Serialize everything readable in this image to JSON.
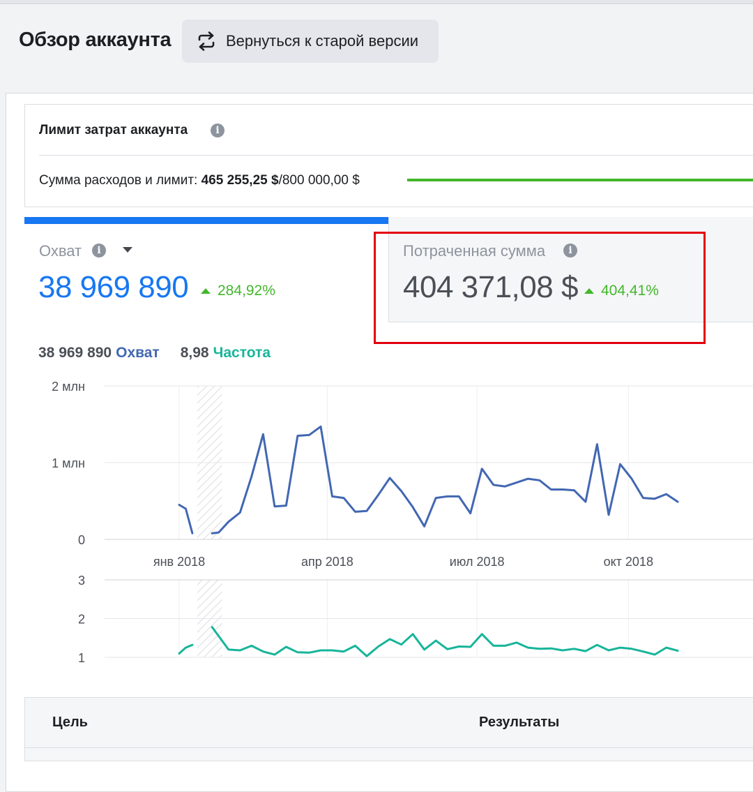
{
  "header": {
    "title": "Обзор аккаунта",
    "back_button": "Вернуться к старой версии",
    "back_icon": "refresh-arrows-icon"
  },
  "spend_limit": {
    "title": "Лимит затрат аккаунта",
    "label": "Сумма расходов и лимит: ",
    "spent": "465 255,25 $",
    "limit": "/800 000,00 $",
    "bar_color": "#42b72a"
  },
  "metrics": {
    "reach": {
      "label": "Охват",
      "value": "38 969 890",
      "change": "284,92%",
      "color": "#1877f2"
    },
    "spend": {
      "label": "Потраченная сумма",
      "value": "404 371,08 $",
      "change": "404,41%"
    }
  },
  "legend": {
    "reach_value": "38 969 890",
    "reach_label": "Охват",
    "freq_value": "8,98",
    "freq_label": "Частота"
  },
  "chart_data": [
    {
      "type": "line",
      "title": "",
      "series": [
        {
          "name": "Охват",
          "color": "#4267b2",
          "segments": [
            [
              [
                "2018-01-01",
                450000
              ],
              [
                "2018-01-05",
                400000
              ],
              [
                "2018-01-09",
                80000
              ]
            ],
            [
              [
                "2018-01-21",
                80000
              ],
              [
                "2018-01-25",
                90000
              ],
              [
                "2018-01-31",
                230000
              ],
              [
                "2018-02-07",
                350000
              ],
              [
                "2018-02-14",
                820000
              ],
              [
                "2018-02-21",
                1370000
              ],
              [
                "2018-02-28",
                430000
              ],
              [
                "2018-03-07",
                440000
              ],
              [
                "2018-03-14",
                1350000
              ],
              [
                "2018-03-21",
                1360000
              ],
              [
                "2018-03-28",
                1470000
              ],
              [
                "2018-04-04",
                560000
              ],
              [
                "2018-04-11",
                540000
              ],
              [
                "2018-04-18",
                360000
              ],
              [
                "2018-04-25",
                370000
              ],
              [
                "2018-05-02",
                580000
              ],
              [
                "2018-05-09",
                800000
              ],
              [
                "2018-05-16",
                630000
              ],
              [
                "2018-05-23",
                420000
              ],
              [
                "2018-05-30",
                170000
              ],
              [
                "2018-06-06",
                540000
              ],
              [
                "2018-06-13",
                560000
              ],
              [
                "2018-06-20",
                560000
              ],
              [
                "2018-06-27",
                340000
              ],
              [
                "2018-07-04",
                920000
              ],
              [
                "2018-07-11",
                710000
              ],
              [
                "2018-07-18",
                690000
              ],
              [
                "2018-07-25",
                740000
              ],
              [
                "2018-08-01",
                790000
              ],
              [
                "2018-08-08",
                770000
              ],
              [
                "2018-08-15",
                650000
              ],
              [
                "2018-08-22",
                650000
              ],
              [
                "2018-08-29",
                640000
              ],
              [
                "2018-09-05",
                490000
              ],
              [
                "2018-09-12",
                1240000
              ],
              [
                "2018-09-19",
                320000
              ],
              [
                "2018-09-26",
                980000
              ],
              [
                "2018-10-03",
                790000
              ],
              [
                "2018-10-10",
                540000
              ],
              [
                "2018-10-17",
                530000
              ],
              [
                "2018-10-24",
                590000
              ],
              [
                "2018-10-31",
                490000
              ]
            ]
          ]
        }
      ],
      "xlabel": "",
      "ylabel": "",
      "ylim": [
        0,
        2000000
      ],
      "ytick_labels": [
        "0",
        "1 млн",
        "2 млн"
      ],
      "xtick_labels": [
        "янв 2018",
        "апр 2018",
        "июл 2018",
        "окт 2018"
      ],
      "grid": true
    },
    {
      "type": "line",
      "title": "",
      "series": [
        {
          "name": "Частота",
          "color": "#17b59a",
          "segments": [
            [
              [
                "2018-01-01",
                1.1
              ],
              [
                "2018-01-05",
                1.25
              ],
              [
                "2018-01-09",
                1.32
              ]
            ],
            [
              [
                "2018-01-21",
                1.78
              ],
              [
                "2018-01-25",
                1.55
              ],
              [
                "2018-01-31",
                1.2
              ],
              [
                "2018-02-07",
                1.18
              ],
              [
                "2018-02-14",
                1.3
              ],
              [
                "2018-02-21",
                1.15
              ],
              [
                "2018-02-28",
                1.07
              ],
              [
                "2018-03-07",
                1.27
              ],
              [
                "2018-03-14",
                1.13
              ],
              [
                "2018-03-21",
                1.12
              ],
              [
                "2018-03-28",
                1.18
              ],
              [
                "2018-04-04",
                1.18
              ],
              [
                "2018-04-11",
                1.15
              ],
              [
                "2018-04-18",
                1.3
              ],
              [
                "2018-04-25",
                1.03
              ],
              [
                "2018-05-02",
                1.28
              ],
              [
                "2018-05-09",
                1.47
              ],
              [
                "2018-05-16",
                1.33
              ],
              [
                "2018-05-23",
                1.6
              ],
              [
                "2018-05-30",
                1.2
              ],
              [
                "2018-06-06",
                1.43
              ],
              [
                "2018-06-13",
                1.21
              ],
              [
                "2018-06-20",
                1.28
              ],
              [
                "2018-06-27",
                1.27
              ],
              [
                "2018-07-04",
                1.6
              ],
              [
                "2018-07-11",
                1.3
              ],
              [
                "2018-07-18",
                1.3
              ],
              [
                "2018-07-25",
                1.38
              ],
              [
                "2018-08-01",
                1.25
              ],
              [
                "2018-08-08",
                1.22
              ],
              [
                "2018-08-15",
                1.23
              ],
              [
                "2018-08-22",
                1.18
              ],
              [
                "2018-08-29",
                1.22
              ],
              [
                "2018-09-05",
                1.16
              ],
              [
                "2018-09-12",
                1.32
              ],
              [
                "2018-09-19",
                1.18
              ],
              [
                "2018-09-26",
                1.25
              ],
              [
                "2018-10-03",
                1.22
              ],
              [
                "2018-10-10",
                1.15
              ],
              [
                "2018-10-17",
                1.07
              ],
              [
                "2018-10-24",
                1.25
              ],
              [
                "2018-10-31",
                1.17
              ]
            ]
          ]
        }
      ],
      "xlabel": "",
      "ylabel": "",
      "ylim": [
        1,
        3
      ],
      "ytick_labels": [
        "1",
        "2",
        "3"
      ],
      "grid": true
    }
  ],
  "table": {
    "col_goal": "Цель",
    "col_results": "Результаты"
  }
}
